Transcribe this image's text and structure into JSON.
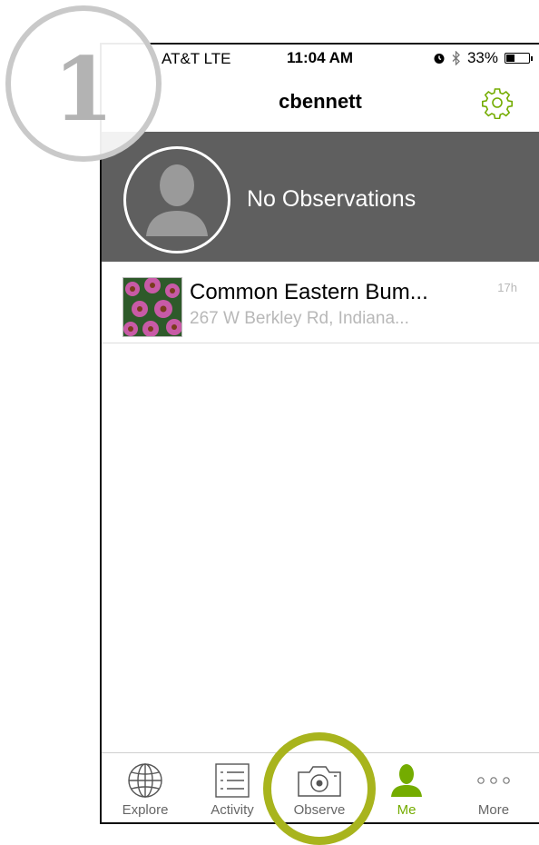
{
  "annotation": {
    "step_number": "1",
    "ring_color": "#a8b41d"
  },
  "status_bar": {
    "carrier": "AT&T  LTE",
    "time": "11:04 AM",
    "battery": "33%",
    "battery_level": 0.33
  },
  "navbar": {
    "title": "cbennett",
    "settings_icon": "gear-icon"
  },
  "profile": {
    "observations_text": "No Observations",
    "avatar_icon": "person-silhouette-icon"
  },
  "observations": [
    {
      "title": "Common Eastern Bum...",
      "location": "267 W Berkley Rd, Indiana...",
      "age": "17h",
      "thumbnail": "coneflower-photo"
    }
  ],
  "tabs": [
    {
      "label": "Explore",
      "icon": "globe-icon"
    },
    {
      "label": "Activity",
      "icon": "list-icon"
    },
    {
      "label": "Observe",
      "icon": "camera-icon"
    },
    {
      "label": "Me",
      "icon": "person-icon",
      "active": true
    },
    {
      "label": "More",
      "icon": "ellipsis-icon"
    }
  ],
  "colors": {
    "accent": "#74ac00",
    "profile_bg": "#5f5f5f"
  }
}
